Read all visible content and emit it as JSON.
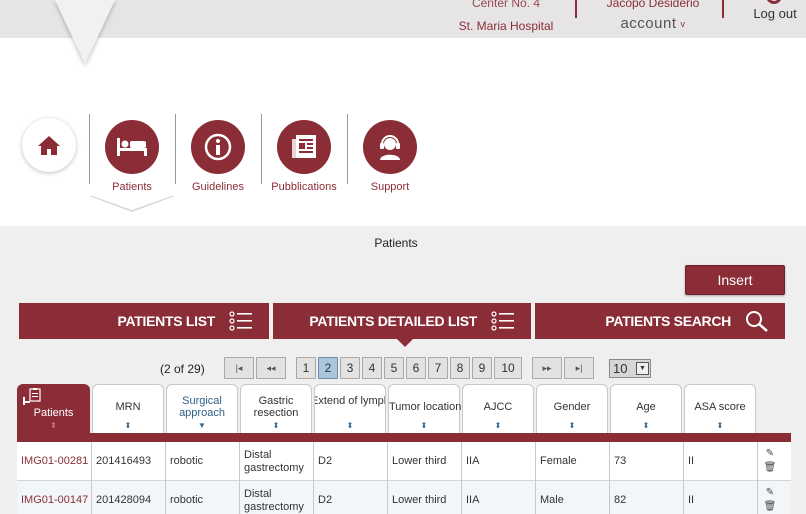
{
  "header": {
    "center_label": "Center No. 4",
    "hospital": "St. Maria Hospital",
    "user_name": "Jacopo Desiderio",
    "account_label": "account",
    "account_chevron": "v",
    "logout_label": "Log out"
  },
  "nav": {
    "items": [
      {
        "label": "Patients",
        "icon": "bed-icon"
      },
      {
        "label": "Guidelines",
        "icon": "info-icon"
      },
      {
        "label": "Pubblications",
        "icon": "newspaper-icon"
      },
      {
        "label": "Support",
        "icon": "headset-icon"
      }
    ],
    "home_icon": "home-icon",
    "active": "Patients"
  },
  "content": {
    "title": "Patients",
    "insert_label": "Insert",
    "tabs": [
      {
        "label": "PATIENTS LIST",
        "icon": "list-icon"
      },
      {
        "label": "PATIENTS DETAILED LIST",
        "icon": "list-icon"
      },
      {
        "label": "PATIENTS SEARCH",
        "icon": "search-icon"
      }
    ],
    "active_tab": "PATIENTS DETAILED LIST"
  },
  "pager": {
    "count": "(2 of 29)",
    "first": "|◂",
    "prev": "◂◂",
    "pages": [
      "1",
      "2",
      "3",
      "4",
      "5",
      "6",
      "7",
      "8",
      "9",
      "10"
    ],
    "current_page": "2",
    "next": "▸▸",
    "last": "▸|",
    "page_size": "10",
    "size_arrow": "▼"
  },
  "table": {
    "columns": [
      "Patients",
      "MRN",
      "Surgical approach",
      "Gastric resection",
      "Extend of lymphadenectomy",
      "Tumor location",
      "AJCC",
      "Gender",
      "Age",
      "ASA score"
    ],
    "column_display": [
      "Patients",
      "MRN",
      "Surgical approach",
      "Gastric resection",
      "Extend of lymphadenector",
      "Tumor location",
      "AJCC",
      "Gender",
      "Age",
      "ASA score"
    ],
    "sorted_column": "Surgical approach",
    "sort_glyph": "⬍",
    "sorted_glyph": "▼",
    "rows": [
      [
        "IMG01-00281",
        "201416493",
        "robotic",
        "Distal gastrectomy",
        "D2",
        "Lower third",
        "IIA",
        "Female",
        "73",
        "II"
      ],
      [
        "IMG01-00147",
        "201428094",
        "robotic",
        "Distal gastrectomy",
        "D2",
        "Lower third",
        "IIA",
        "Male",
        "82",
        "II"
      ]
    ],
    "edit_glyph": "✎",
    "delete_glyph": "🗑"
  },
  "colors": {
    "brand": "#8b2d37",
    "page_bg": "#efefef",
    "current_page": "#a8c6dd"
  }
}
